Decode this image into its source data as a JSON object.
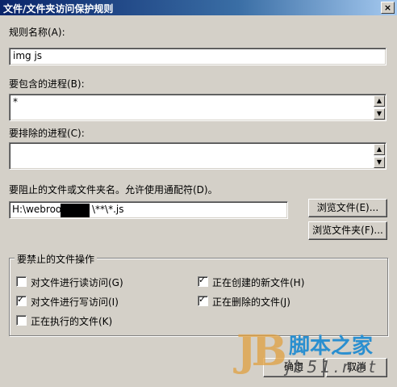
{
  "window": {
    "title": "文件/文件夹访问保护规则",
    "close_glyph": "×"
  },
  "rule_name": {
    "label": "规则名称(A):",
    "value": "img js"
  },
  "include_processes": {
    "label": "要包含的进程(B):",
    "value": "*"
  },
  "exclude_processes": {
    "label": "要排除的进程(C):",
    "value": ""
  },
  "blocked_path": {
    "label": "要阻止的文件或文件夹名。允许使用通配符(D)。",
    "value_prefix": "H:\\webroot\\",
    "value_suffix": "\\**\\*.js"
  },
  "buttons": {
    "browse_file": "浏览文件(E)...",
    "browse_folder": "浏览文件夹(F)...",
    "ok": "确定",
    "cancel": "取消"
  },
  "operations": {
    "group_label": "要禁止的文件操作",
    "items": [
      {
        "label": "对文件进行读访问(G)",
        "checked": false
      },
      {
        "label": "对文件进行写访问(I)",
        "checked": true
      },
      {
        "label": "正在执行的文件(K)",
        "checked": false
      },
      {
        "label": "正在创建的新文件(H)",
        "checked": true
      },
      {
        "label": "正在删除的文件(J)",
        "checked": true
      }
    ],
    "check_glyph": "✓"
  },
  "watermark": {
    "logo": "JB",
    "name": "脚本之家",
    "url": "jb51.net"
  },
  "scroll_glyphs": {
    "up": "▲",
    "down": "▼"
  }
}
